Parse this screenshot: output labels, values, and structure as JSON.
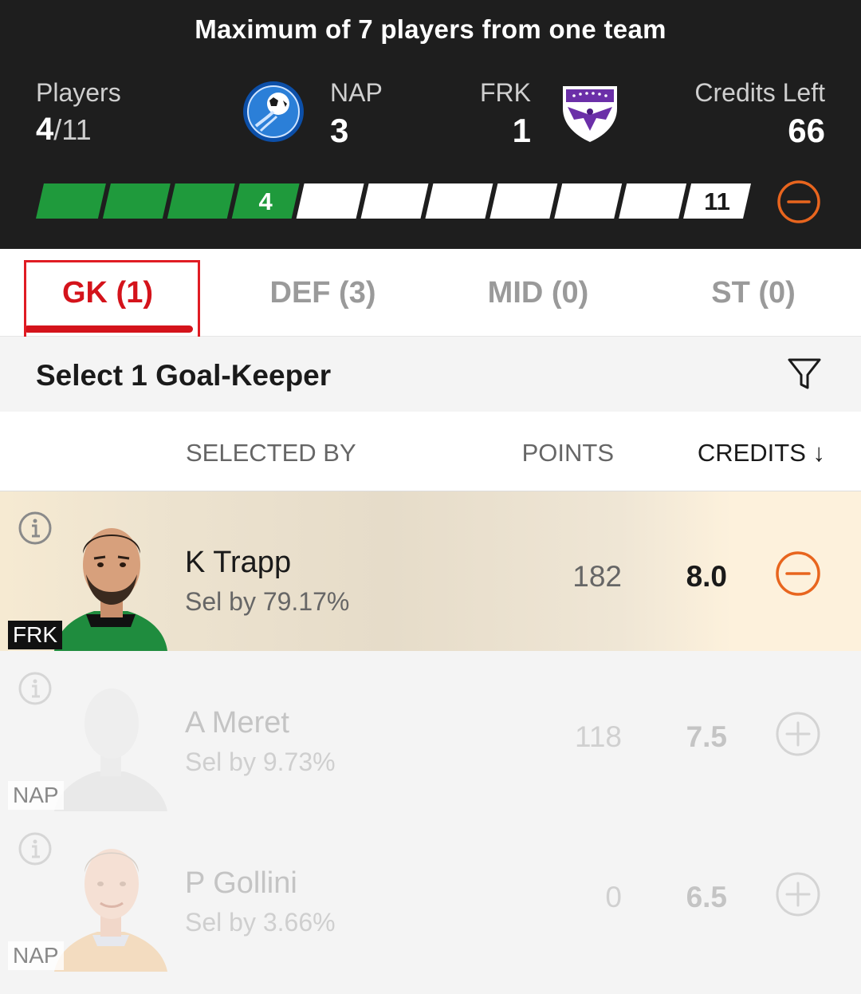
{
  "header": {
    "rule_text": "Maximum of 7 players from one team",
    "players_label": "Players",
    "players_selected": "4",
    "players_total": "/11",
    "team1": {
      "name": "NAP",
      "count": "3"
    },
    "team2": {
      "name": "FRK",
      "count": "1"
    },
    "credits_label": "Credits Left",
    "credits_value": "66",
    "progress": {
      "filled": 4,
      "total": 11,
      "filled_label": "4",
      "total_label": "11"
    },
    "colors": {
      "progress_green": "#1f9a3c",
      "accent_orange": "#e8651e",
      "header_bg": "#1e1e1e"
    }
  },
  "tabs": [
    {
      "label": "GK (1)",
      "active": true
    },
    {
      "label": "DEF (3)",
      "active": false
    },
    {
      "label": "MID (0)",
      "active": false
    },
    {
      "label": "ST (0)",
      "active": false
    }
  ],
  "section": {
    "title": "Select 1 Goal-Keeper",
    "filter_icon": "filter-icon"
  },
  "columns": {
    "selected_by": "SELECTED BY",
    "points": "POINTS",
    "credits": "CREDITS ↓"
  },
  "players": [
    {
      "name": "K Trapp",
      "sel": "Sel by 79.17%",
      "points": "182",
      "credits": "8.0",
      "team": "FRK",
      "selected": true,
      "action_icon": "minus-circle-icon"
    },
    {
      "name": "A Meret",
      "sel": "Sel by 9.73%",
      "points": "118",
      "credits": "7.5",
      "team": "NAP",
      "selected": false,
      "action_icon": "plus-circle-icon"
    },
    {
      "name": "P Gollini",
      "sel": "Sel by 3.66%",
      "points": "0",
      "credits": "6.5",
      "team": "NAP",
      "selected": false,
      "action_icon": "plus-circle-icon"
    }
  ]
}
